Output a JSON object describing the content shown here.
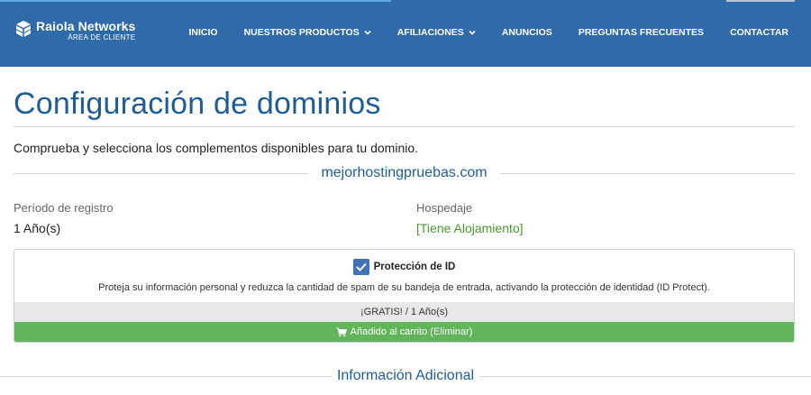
{
  "brand": {
    "name": "Raiola Networks",
    "subtitle": "ÁREA DE CLIENTE",
    "icon": "cube-logo-icon"
  },
  "nav": {
    "items": [
      {
        "label": "INICIO",
        "dropdown": false
      },
      {
        "label": "NUESTROS PRODUCTOS",
        "dropdown": true
      },
      {
        "label": "AFILIACIONES",
        "dropdown": true
      },
      {
        "label": "ANUNCIOS",
        "dropdown": false
      },
      {
        "label": "PREGUNTAS FRECUENTES",
        "dropdown": false
      },
      {
        "label": "CONTACTAR",
        "dropdown": false
      }
    ]
  },
  "page": {
    "title": "Configuración de dominios",
    "intro": "Comprueba y selecciona los complementos disponibles para tu dominio.",
    "domain": "mejorhostingpruebas.com"
  },
  "registration": {
    "label": "Período de registro",
    "value": "1 Año(s)"
  },
  "hosting": {
    "label": "Hospedaje",
    "value": "[Tiene Alojamiento]"
  },
  "addon": {
    "name": "Protección de ID",
    "checked": true,
    "description": "Proteja su información personal y reduzca la cantidad de spam de su bandeja de entrada, activando la protección de identidad (ID Protect).",
    "price": "¡GRATIS! / 1 Año(s)",
    "cart_label": "Añadido al carrito (Eliminar)"
  },
  "section2": {
    "title": "Información Adicional"
  },
  "colors": {
    "header_bg": "#2f6aa9",
    "accent_blue": "#1f5d94",
    "green": "#62b55a",
    "checkbox": "#3f73b5"
  }
}
